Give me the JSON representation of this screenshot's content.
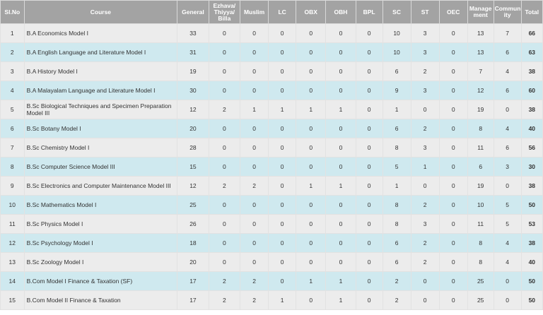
{
  "headers": {
    "slno": "Sl.No",
    "course": "Course",
    "general": "General",
    "ezhava": "Ezhava/ Thiyya/ Billa",
    "muslim": "Muslim",
    "lc": "LC",
    "obx": "OBX",
    "obh": "OBH",
    "bpl": "BPL",
    "sc": "SC",
    "st": "ST",
    "oec": "OEC",
    "management": "Manage ment",
    "community": "Commun ity",
    "total": "Total"
  },
  "rows": [
    {
      "slno": "1",
      "course": "B.A Economics Model I",
      "general": "33",
      "ezhava": "0",
      "muslim": "0",
      "lc": "0",
      "obx": "0",
      "obh": "0",
      "bpl": "0",
      "sc": "10",
      "st": "3",
      "oec": "0",
      "management": "13",
      "community": "7",
      "total": "66"
    },
    {
      "slno": "2",
      "course": "B.A English Language and Literature Model I",
      "general": "31",
      "ezhava": "0",
      "muslim": "0",
      "lc": "0",
      "obx": "0",
      "obh": "0",
      "bpl": "0",
      "sc": "10",
      "st": "3",
      "oec": "0",
      "management": "13",
      "community": "6",
      "total": "63"
    },
    {
      "slno": "3",
      "course": "B.A History Model I",
      "general": "19",
      "ezhava": "0",
      "muslim": "0",
      "lc": "0",
      "obx": "0",
      "obh": "0",
      "bpl": "0",
      "sc": "6",
      "st": "2",
      "oec": "0",
      "management": "7",
      "community": "4",
      "total": "38"
    },
    {
      "slno": "4",
      "course": "B.A Malayalam Language and Literature Model I",
      "general": "30",
      "ezhava": "0",
      "muslim": "0",
      "lc": "0",
      "obx": "0",
      "obh": "0",
      "bpl": "0",
      "sc": "9",
      "st": "3",
      "oec": "0",
      "management": "12",
      "community": "6",
      "total": "60"
    },
    {
      "slno": "5",
      "course": "B.Sc Biological Techniques and Specimen Preparation Model III",
      "general": "12",
      "ezhava": "2",
      "muslim": "1",
      "lc": "1",
      "obx": "1",
      "obh": "1",
      "bpl": "0",
      "sc": "1",
      "st": "0",
      "oec": "0",
      "management": "19",
      "community": "0",
      "total": "38"
    },
    {
      "slno": "6",
      "course": "B.Sc Botany Model I",
      "general": "20",
      "ezhava": "0",
      "muslim": "0",
      "lc": "0",
      "obx": "0",
      "obh": "0",
      "bpl": "0",
      "sc": "6",
      "st": "2",
      "oec": "0",
      "management": "8",
      "community": "4",
      "total": "40"
    },
    {
      "slno": "7",
      "course": "B.Sc Chemistry Model I",
      "general": "28",
      "ezhava": "0",
      "muslim": "0",
      "lc": "0",
      "obx": "0",
      "obh": "0",
      "bpl": "0",
      "sc": "8",
      "st": "3",
      "oec": "0",
      "management": "11",
      "community": "6",
      "total": "56"
    },
    {
      "slno": "8",
      "course": "B.Sc Computer Science Model III",
      "general": "15",
      "ezhava": "0",
      "muslim": "0",
      "lc": "0",
      "obx": "0",
      "obh": "0",
      "bpl": "0",
      "sc": "5",
      "st": "1",
      "oec": "0",
      "management": "6",
      "community": "3",
      "total": "30"
    },
    {
      "slno": "9",
      "course": "B.Sc Electronics and Computer Maintenance Model III",
      "general": "12",
      "ezhava": "2",
      "muslim": "2",
      "lc": "0",
      "obx": "1",
      "obh": "1",
      "bpl": "0",
      "sc": "1",
      "st": "0",
      "oec": "0",
      "management": "19",
      "community": "0",
      "total": "38"
    },
    {
      "slno": "10",
      "course": "B.Sc Mathematics Model I",
      "general": "25",
      "ezhava": "0",
      "muslim": "0",
      "lc": "0",
      "obx": "0",
      "obh": "0",
      "bpl": "0",
      "sc": "8",
      "st": "2",
      "oec": "0",
      "management": "10",
      "community": "5",
      "total": "50"
    },
    {
      "slno": "11",
      "course": "B.Sc Physics Model I",
      "general": "26",
      "ezhava": "0",
      "muslim": "0",
      "lc": "0",
      "obx": "0",
      "obh": "0",
      "bpl": "0",
      "sc": "8",
      "st": "3",
      "oec": "0",
      "management": "11",
      "community": "5",
      "total": "53"
    },
    {
      "slno": "12",
      "course": "B.Sc Psychology Model I",
      "general": "18",
      "ezhava": "0",
      "muslim": "0",
      "lc": "0",
      "obx": "0",
      "obh": "0",
      "bpl": "0",
      "sc": "6",
      "st": "2",
      "oec": "0",
      "management": "8",
      "community": "4",
      "total": "38"
    },
    {
      "slno": "13",
      "course": "B.Sc Zoology Model I",
      "general": "20",
      "ezhava": "0",
      "muslim": "0",
      "lc": "0",
      "obx": "0",
      "obh": "0",
      "bpl": "0",
      "sc": "6",
      "st": "2",
      "oec": "0",
      "management": "8",
      "community": "4",
      "total": "40"
    },
    {
      "slno": "14",
      "course": "B.Com Model I Finance & Taxation (SF)",
      "general": "17",
      "ezhava": "2",
      "muslim": "2",
      "lc": "0",
      "obx": "1",
      "obh": "1",
      "bpl": "0",
      "sc": "2",
      "st": "0",
      "oec": "0",
      "management": "25",
      "community": "0",
      "total": "50"
    },
    {
      "slno": "15",
      "course": "B.Com Model II Finance & Taxation",
      "general": "17",
      "ezhava": "2",
      "muslim": "2",
      "lc": "1",
      "obx": "0",
      "obh": "1",
      "bpl": "0",
      "sc": "2",
      "st": "0",
      "oec": "0",
      "management": "25",
      "community": "0",
      "total": "50"
    }
  ],
  "colors": {
    "header_bg": "#a3a3a3",
    "row_odd_bg": "#ececec",
    "row_even_bg": "#cfe9ef"
  }
}
